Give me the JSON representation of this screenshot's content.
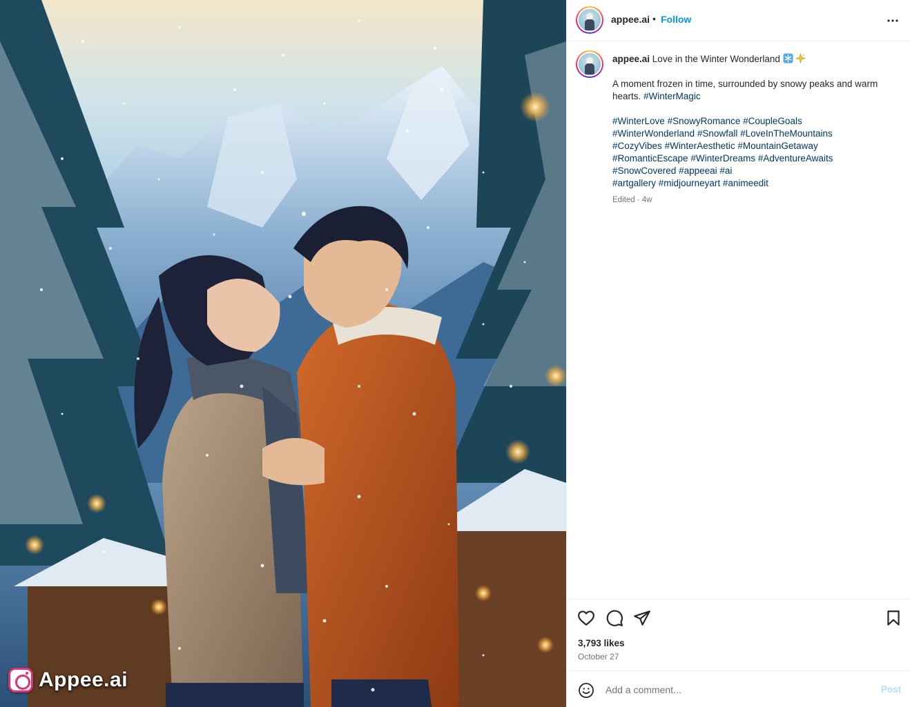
{
  "colors": {
    "follow": "#0095f6",
    "hashtag": "#00376b",
    "muted": "#737373",
    "post_disabled": "#b2dffc",
    "watermark_logo": "#e1306c"
  },
  "image": {
    "description_icon": "couple-in-winter-illustration",
    "watermark_text": "Appee.ai",
    "watermark_icon": "instagram-logo-icon"
  },
  "header": {
    "username": "appee.ai",
    "separator": "•",
    "follow_label": "Follow",
    "more_icon": "more-options-icon"
  },
  "caption": {
    "username": "appee.ai",
    "title": "Love in the Winter Wonderland",
    "title_emojis": [
      "snowflake-emoji",
      "sparkles-emoji"
    ],
    "text_line": "A moment frozen in time, surrounded by snowy peaks and warm hearts.",
    "inline_tag": "#WinterMagic",
    "hashtag_lines": [
      [
        "#WinterLove",
        "#SnowyRomance",
        "#CoupleGoals"
      ],
      [
        "#WinterWonderland",
        "#Snowfall",
        "#LoveInTheMountains"
      ],
      [
        "#CozyVibes",
        "#WinterAesthetic",
        "#MountainGetaway"
      ],
      [
        "#RomanticEscape",
        "#WinterDreams",
        "#AdventureAwaits"
      ],
      [
        "#SnowCovered",
        "#appeeai",
        "#ai"
      ],
      [
        "#artgallery",
        "#midjourneyart",
        "#animeedit"
      ]
    ],
    "meta": "Edited · 4w"
  },
  "actions": {
    "icons": [
      "heart-icon",
      "comment-icon",
      "share-icon",
      "bookmark-icon"
    ],
    "likes": "3,793 likes",
    "date": "October 27"
  },
  "comment": {
    "placeholder": "Add a comment...",
    "post_label": "Post",
    "emoji_icon": "emoji-icon"
  }
}
